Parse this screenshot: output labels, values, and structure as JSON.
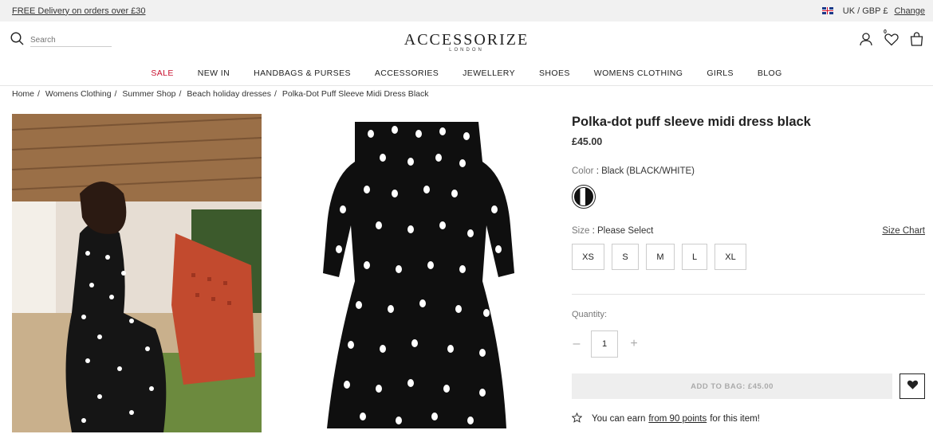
{
  "topbar": {
    "delivery": "FREE Delivery on orders over £30",
    "region": "UK / GBP £",
    "change": "Change"
  },
  "header": {
    "search_placeholder": "Search",
    "brand": "ACCESSORIZE",
    "brand_sub": "LONDON",
    "wishlist_count": "0"
  },
  "nav": {
    "items": [
      "SALE",
      "NEW IN",
      "HANDBAGS & PURSES",
      "ACCESSORIES",
      "JEWELLERY",
      "SHOES",
      "WOMENS CLOTHING",
      "GIRLS",
      "BLOG"
    ]
  },
  "breadcrumb": [
    "Home",
    "Womens Clothing",
    "Summer Shop",
    "Beach holiday dresses",
    "Polka-Dot Puff Sleeve Midi Dress Black"
  ],
  "product": {
    "title": "Polka-dot puff sleeve midi dress black",
    "price": "£45.00",
    "color_label": "Color",
    "color_value": "Black (BLACK/WHITE)",
    "size_label": "Size",
    "size_value": "Please Select",
    "size_chart": "Size Chart",
    "sizes": [
      "XS",
      "S",
      "M",
      "L",
      "XL"
    ],
    "quantity_label": "Quantity:",
    "quantity": "1",
    "add_to_bag": "ADD TO BAG: £45.00",
    "points_prefix": "You can earn",
    "points_link": "from 90 points",
    "points_suffix": "for this item!"
  },
  "colors": {
    "sale": "#c8102e",
    "add_bag_bg": "#eeeeee"
  }
}
